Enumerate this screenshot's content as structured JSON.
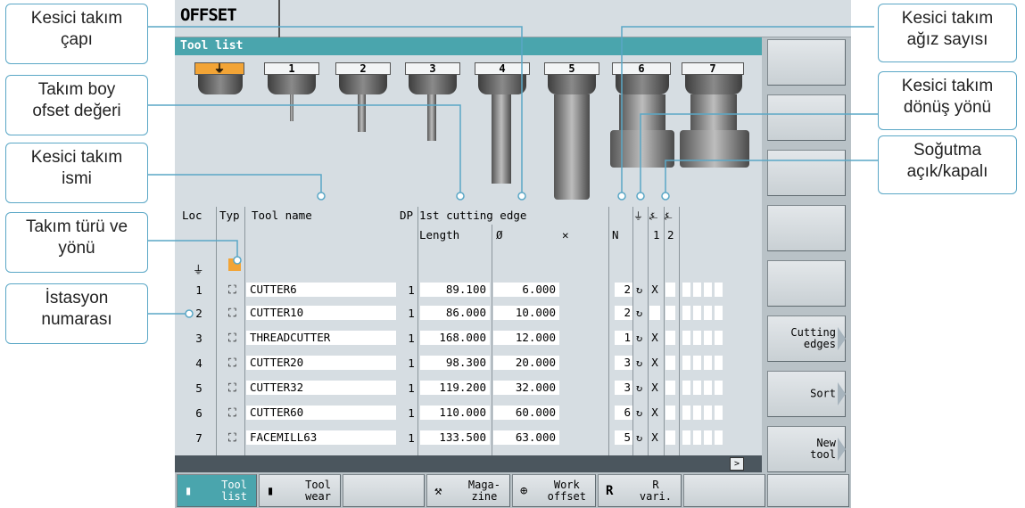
{
  "title": "OFFSET",
  "list_header": "Tool list",
  "tool_slots": [
    "1",
    "2",
    "3",
    "4",
    "5",
    "6",
    "7"
  ],
  "columns": {
    "loc": "Loc",
    "typ": "Typ",
    "tool_name": "Tool name",
    "dp": "DP",
    "cutting_edge": "1st cutting edge",
    "length": "Length",
    "diameter": "Ø",
    "n": "N",
    "coolant_1": "1",
    "coolant_2": "2"
  },
  "spindle_location_symbol": "⏚",
  "rows": [
    {
      "loc": "1",
      "name": "CUTTER6",
      "dp": "1",
      "length": "89.100",
      "diameter": "6.000",
      "n": "2",
      "coolant": "X"
    },
    {
      "loc": "2",
      "name": "CUTTER10",
      "dp": "1",
      "length": "86.000",
      "diameter": "10.000",
      "n": "2",
      "coolant": ""
    },
    {
      "loc": "3",
      "name": "THREADCUTTER",
      "dp": "1",
      "length": "168.000",
      "diameter": "12.000",
      "n": "1",
      "coolant": "X"
    },
    {
      "loc": "4",
      "name": "CUTTER20",
      "dp": "1",
      "length": "98.300",
      "diameter": "20.000",
      "n": "3",
      "coolant": "X"
    },
    {
      "loc": "5",
      "name": "CUTTER32",
      "dp": "1",
      "length": "119.200",
      "diameter": "32.000",
      "n": "3",
      "coolant": "X"
    },
    {
      "loc": "6",
      "name": "CUTTER60",
      "dp": "1",
      "length": "110.000",
      "diameter": "60.000",
      "n": "6",
      "coolant": "X"
    },
    {
      "loc": "7",
      "name": "FACEMILL63",
      "dp": "1",
      "length": "133.500",
      "diameter": "63.000",
      "n": "5",
      "coolant": "X"
    }
  ],
  "softkeys_right": [
    "",
    "",
    "",
    "",
    "",
    "Cutting\nedges",
    "Sort",
    "New\ntool"
  ],
  "softkeys_bottom": [
    {
      "label": "Tool\nlist",
      "active": true
    },
    {
      "label": "Tool\nwear",
      "active": false
    },
    {
      "label": "",
      "active": false
    },
    {
      "label": "Maga-\nzine",
      "active": false
    },
    {
      "label": "Work\noffset",
      "active": false
    },
    {
      "label": "R\nvari.",
      "active": false
    },
    {
      "label": "",
      "active": false
    },
    {
      "label": "",
      "active": false
    }
  ],
  "callouts": {
    "diameter": "Kesici takım\nçapı",
    "length_offset": "Takım boy\nofset değeri",
    "tool_name": "Kesici takım\nismi",
    "tool_type": "Takım türü ve\nyönü",
    "station": "İstasyon\nnumarası",
    "edge_count": "Kesici takım\nağız sayısı",
    "rotation": "Kesici takım\ndönüş yönü",
    "coolant": "Soğutma\naçık/kapalı"
  },
  "colors": {
    "accent": "#4aa5ad",
    "selected_slot": "#f2a436",
    "callout_border": "#5aa7c6"
  }
}
